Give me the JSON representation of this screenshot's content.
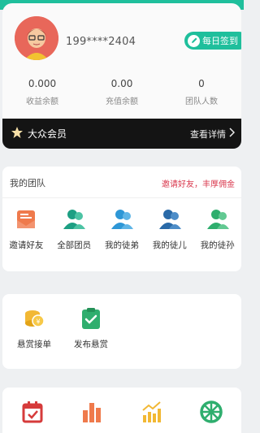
{
  "user": {
    "phone": "199****2404",
    "checkin_label": "每日签到"
  },
  "stats": [
    {
      "value": "0.000",
      "label": "收益余额"
    },
    {
      "value": "0.00",
      "label": "充值余额"
    },
    {
      "value": "0",
      "label": "团队人数"
    }
  ],
  "member": {
    "level": "大众会员",
    "detail_link": "查看详情"
  },
  "team": {
    "title": "我的团队",
    "invite_text": "邀请好友，丰厚佣金",
    "items": [
      {
        "label": "邀请好友",
        "icon": "invite-envelope-icon"
      },
      {
        "label": "全部团员",
        "icon": "all-members-icon"
      },
      {
        "label": "我的徒弟",
        "icon": "apprentice-icon"
      },
      {
        "label": "我的徒儿",
        "icon": "disciple-icon"
      },
      {
        "label": "我的徒孙",
        "icon": "grand-apprentice-icon"
      }
    ]
  },
  "bounty": {
    "items": [
      {
        "label": "悬赏接单",
        "icon": "coins-icon"
      },
      {
        "label": "发布悬赏",
        "icon": "clipboard-check-icon"
      }
    ]
  },
  "tools": {
    "items": [
      {
        "icon": "calendar-check-icon"
      },
      {
        "icon": "bar-chart-icon"
      },
      {
        "icon": "growth-chart-icon"
      },
      {
        "icon": "wheel-icon"
      }
    ]
  },
  "colors": {
    "accent": "#1fbf9c",
    "invite_red": "#d9374c",
    "member_bar": "#141414"
  }
}
